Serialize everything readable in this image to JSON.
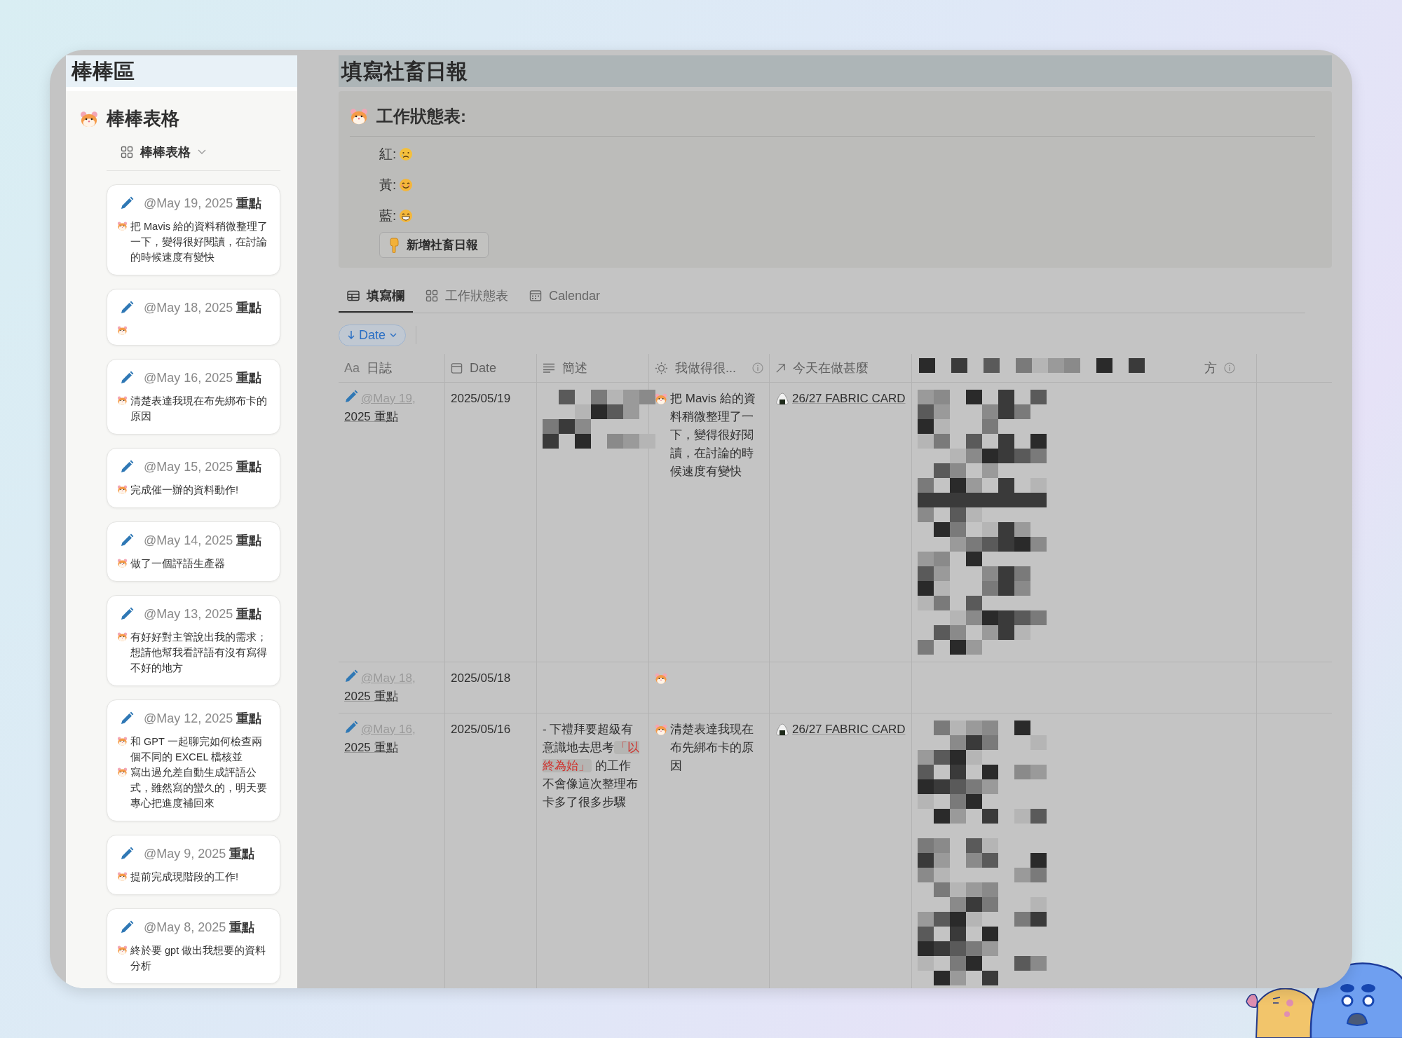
{
  "sidebar": {
    "heading": "棒棒區",
    "database_title": "棒棒表格",
    "view": {
      "label": "棒棒表格"
    },
    "cards": [
      {
        "mention": "@May 19, 2025",
        "title": "重點",
        "lines": [
          {
            "kind": "bullet",
            "text": "把 Mavis 給的資料稍微整理了一下，變得很好閱讀，在討論的時候速度有變快"
          }
        ]
      },
      {
        "mention": "@May 18, 2025",
        "title": "重點",
        "lines": [
          {
            "kind": "bullet"
          }
        ]
      },
      {
        "mention": "@May 16, 2025",
        "title": "重點",
        "lines": [
          {
            "kind": "bullet",
            "text": "清楚表達我現在布先綁布卡的原因"
          }
        ]
      },
      {
        "mention": "@May 15, 2025",
        "title": "重點",
        "lines": [
          {
            "kind": "bullet",
            "text": "完成催一辦的資料動作!"
          }
        ]
      },
      {
        "mention": "@May 14, 2025",
        "title": "重點",
        "lines": [
          {
            "kind": "bullet",
            "text": "做了一個評語生產器"
          }
        ]
      },
      {
        "mention": "@May 13, 2025",
        "title": "重點",
        "lines": [
          {
            "kind": "bullet",
            "text": "有好好對主管說出我的需求；想請他幫我看評語有沒有寫得不好的地方"
          }
        ]
      },
      {
        "mention": "@May 12, 2025",
        "title": "重點",
        "lines": [
          {
            "kind": "bullet",
            "text": "和 GPT 一起聊完如何檢查兩個不同的 EXCEL 檔核並"
          },
          {
            "kind": "bullet",
            "text": "寫出過允差自動生成評語公式，雖然寫的蠻久的，明天要專心把進度補回來"
          }
        ]
      },
      {
        "mention": "@May 9, 2025",
        "title": "重點",
        "lines": [
          {
            "kind": "bullet",
            "text": "提前完成現階段的工作!"
          }
        ]
      },
      {
        "mention": "@May 8, 2025",
        "title": "重點",
        "lines": [
          {
            "kind": "bullet",
            "text": "終於要 gpt 做出我想要的資料分析"
          }
        ]
      }
    ]
  },
  "page": {
    "title": "填寫社畜日報",
    "callout": {
      "title": "工作狀態表:",
      "items": [
        {
          "label": "紅:",
          "kind": "teary"
        },
        {
          "label": "黃:",
          "kind": "smile"
        },
        {
          "label": "藍:",
          "kind": "grin"
        }
      ],
      "button": "新增社畜日報"
    },
    "tabs": [
      {
        "label": "填寫欄",
        "kind": "table",
        "selected": true
      },
      {
        "label": "工作狀態表",
        "kind": "gallery",
        "selected": false
      },
      {
        "label": "Calendar",
        "kind": "calendar",
        "selected": false
      }
    ],
    "sort": {
      "label": "Date"
    },
    "table": {
      "columns": [
        {
          "kind": "title",
          "glyph": "Aa",
          "label": "日誌"
        },
        {
          "kind": "date",
          "label": "Date"
        },
        {
          "kind": "text",
          "label": "簡述"
        },
        {
          "kind": "formula",
          "label": "我做得很...",
          "info": true
        },
        {
          "kind": "relation",
          "label": "今天在做甚麼"
        },
        {
          "kind": "redacted",
          "label": "方",
          "info": true,
          "redacted": true
        }
      ],
      "rows": [
        {
          "log": {
            "mention": "@May 19,",
            "title": "2025 重點"
          },
          "date": "2025/05/19",
          "summary": {
            "redacted": true
          },
          "evaluation": {
            "kind": "bullet",
            "text": "把 Mavis 給的資料稍微整理了一下，變得很好閱讀，在討論的時候速度有變快"
          },
          "activity": {
            "link": "26/27 FABRIC CARD"
          },
          "column_6": {
            "redacted": true
          }
        },
        {
          "log": {
            "mention": "@May 18,",
            "title": "2025 重點"
          },
          "date": "2025/05/18",
          "evaluation": {
            "kind": "bullet"
          }
        },
        {
          "log": {
            "mention": "@May 16,",
            "title": "2025 重點"
          },
          "date": "2025/05/16",
          "summary": {
            "text": "- 下禮拜要超級有意識地去思考",
            "highlight": "「以終為始」",
            "after": " 的工作",
            "next_line": "不會像這次整理布卡多了很多步驟"
          },
          "evaluation": {
            "kind": "bullet",
            "text": "清楚表達我現在布先綁布卡的原因"
          },
          "activity": {
            "link": "26/27 FABRIC CARD"
          },
          "column_6": {
            "redacted": true
          }
        }
      ]
    }
  }
}
